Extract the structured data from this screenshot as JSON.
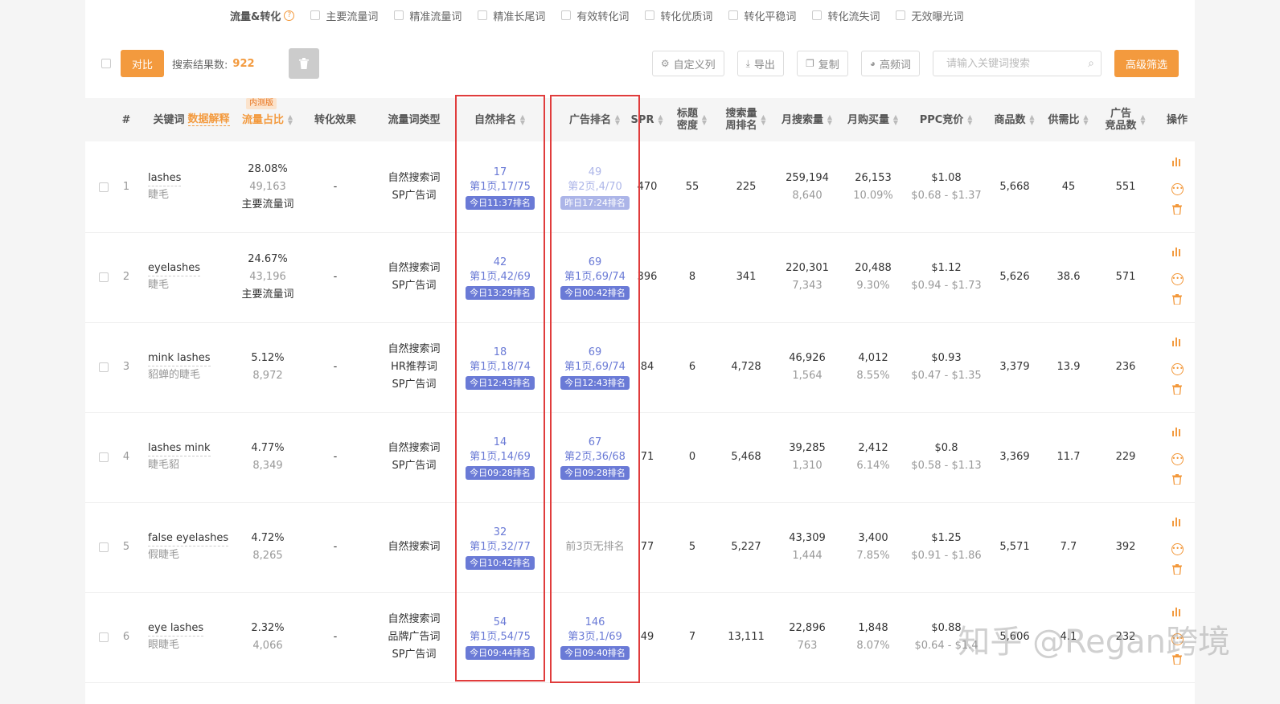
{
  "filters": {
    "title": "流量&转化",
    "help": "?",
    "options": [
      "主要流量词",
      "精准流量词",
      "精准长尾词",
      "有效转化词",
      "转化优质词",
      "转化平稳词",
      "转化流失词",
      "无效曝光词"
    ]
  },
  "toolbar": {
    "compare_label": "对比",
    "result_label": "搜索结果数:",
    "result_count": "922",
    "custom_cols_label": "自定义列",
    "export_label": "导出",
    "copy_label": "复制",
    "high_freq_label": "高频词",
    "search_placeholder": "请输入关键词搜索",
    "advanced_label": "高级筛选"
  },
  "columns": {
    "index": "#",
    "keyword": "关键词",
    "data_explain": "数据解释",
    "traffic_share": "流量占比",
    "beta_badge": "内测版",
    "conversion": "转化效果",
    "traffic_type": "流量词类型",
    "natural_rank": "自然排名",
    "ad_rank": "广告排名",
    "spr": "SPR",
    "title_density_1": "标题",
    "title_density_2": "密度",
    "weekly_rank_1": "搜索量",
    "weekly_rank_2": "周排名",
    "monthly_search": "月搜索量",
    "monthly_purchase": "月购买量",
    "ppc": "PPC竞价",
    "products": "商品数",
    "supply_demand": "供需比",
    "ad_products_1": "广告",
    "ad_products_2": "竞品数",
    "actions": "操作"
  },
  "rows": [
    {
      "idx": "1",
      "kw": "lashes",
      "kw_cn": "睫毛",
      "share": "28.08%",
      "share_val": "49,163",
      "share_tag": "主要流量词",
      "conv": "-",
      "types": [
        "自然搜索词",
        "SP广告词"
      ],
      "nat_num": "17",
      "nat_pg": "第1页,17/75",
      "nat_tag": "今日11:37排名",
      "ad_num": "49",
      "ad_pg": "第2页,4/70",
      "ad_tag": "昨日17:24排名",
      "ad_faded": true,
      "ad_none": "",
      "spr": "470",
      "density": "55",
      "weekly": "225",
      "msearch": "259,194",
      "msearch_sub": "8,640",
      "mbuy": "26,153",
      "mbuy_sub": "10.09%",
      "ppc": "$1.08",
      "ppc_range": "$0.68 - $1.37",
      "products": "5,668",
      "sd": "45",
      "adp": "551"
    },
    {
      "idx": "2",
      "kw": "eyelashes",
      "kw_cn": "睫毛",
      "share": "24.67%",
      "share_val": "43,196",
      "share_tag": "主要流量词",
      "conv": "-",
      "types": [
        "自然搜索词",
        "SP广告词"
      ],
      "nat_num": "42",
      "nat_pg": "第1页,42/69",
      "nat_tag": "今日13:29排名",
      "ad_num": "69",
      "ad_pg": "第1页,69/74",
      "ad_tag": "今日00:42排名",
      "ad_faded": false,
      "ad_none": "",
      "spr": "396",
      "density": "8",
      "weekly": "341",
      "msearch": "220,301",
      "msearch_sub": "7,343",
      "mbuy": "20,488",
      "mbuy_sub": "9.30%",
      "ppc": "$1.12",
      "ppc_range": "$0.94 - $1.73",
      "products": "5,626",
      "sd": "38.6",
      "adp": "571"
    },
    {
      "idx": "3",
      "kw": "mink lashes",
      "kw_cn": "貂蝉的睫毛",
      "share": "5.12%",
      "share_val": "8,972",
      "share_tag": "",
      "conv": "-",
      "types": [
        "自然搜索词",
        "HR推荐词",
        "SP广告词"
      ],
      "nat_num": "18",
      "nat_pg": "第1页,18/74",
      "nat_tag": "今日12:43排名",
      "ad_num": "69",
      "ad_pg": "第1页,69/74",
      "ad_tag": "今日12:43排名",
      "ad_faded": false,
      "ad_none": "",
      "spr": "84",
      "density": "6",
      "weekly": "4,728",
      "msearch": "46,926",
      "msearch_sub": "1,564",
      "mbuy": "4,012",
      "mbuy_sub": "8.55%",
      "ppc": "$0.93",
      "ppc_range": "$0.47 - $1.35",
      "products": "3,379",
      "sd": "13.9",
      "adp": "236"
    },
    {
      "idx": "4",
      "kw": "lashes mink",
      "kw_cn": "睫毛貂",
      "share": "4.77%",
      "share_val": "8,349",
      "share_tag": "",
      "conv": "-",
      "types": [
        "自然搜索词",
        "SP广告词"
      ],
      "nat_num": "14",
      "nat_pg": "第1页,14/69",
      "nat_tag": "今日09:28排名",
      "ad_num": "67",
      "ad_pg": "第2页,36/68",
      "ad_tag": "今日09:28排名",
      "ad_faded": false,
      "ad_none": "",
      "spr": "71",
      "density": "0",
      "weekly": "5,468",
      "msearch": "39,285",
      "msearch_sub": "1,310",
      "mbuy": "2,412",
      "mbuy_sub": "6.14%",
      "ppc": "$0.8",
      "ppc_range": "$0.58 - $1.13",
      "products": "3,369",
      "sd": "11.7",
      "adp": "229"
    },
    {
      "idx": "5",
      "kw": "false eyelashes",
      "kw_cn": "假睫毛",
      "share": "4.72%",
      "share_val": "8,265",
      "share_tag": "",
      "conv": "-",
      "types": [
        "自然搜索词"
      ],
      "nat_num": "32",
      "nat_pg": "第1页,32/77",
      "nat_tag": "今日10:42排名",
      "ad_num": "",
      "ad_pg": "",
      "ad_tag": "",
      "ad_faded": false,
      "ad_none": "前3页无排名",
      "spr": "77",
      "density": "5",
      "weekly": "5,227",
      "msearch": "43,309",
      "msearch_sub": "1,444",
      "mbuy": "3,400",
      "mbuy_sub": "7.85%",
      "ppc": "$1.25",
      "ppc_range": "$0.91 - $1.86",
      "products": "5,571",
      "sd": "7.7",
      "adp": "392"
    },
    {
      "idx": "6",
      "kw": "eye lashes",
      "kw_cn": "眼睫毛",
      "share": "2.32%",
      "share_val": "4,066",
      "share_tag": "",
      "conv": "-",
      "types": [
        "自然搜索词",
        "品牌广告词",
        "SP广告词"
      ],
      "nat_num": "54",
      "nat_pg": "第1页,54/75",
      "nat_tag": "今日09:44排名",
      "ad_num": "146",
      "ad_pg": "第3页,1/69",
      "ad_tag": "今日09:40排名",
      "ad_faded": false,
      "ad_none": "",
      "spr": "49",
      "density": "7",
      "weekly": "13,111",
      "msearch": "22,896",
      "msearch_sub": "763",
      "mbuy": "1,848",
      "mbuy_sub": "8.07%",
      "ppc": "$0.88",
      "ppc_range": "$0.64 - $1.4",
      "products": "5,606",
      "sd": "4.1",
      "adp": "232"
    }
  ],
  "icons": {
    "chart": "bar-chart-icon",
    "more": "more-icon",
    "delete": "trash-icon"
  },
  "watermark": "知乎 @Regan跨境",
  "accent": "#f39a3e",
  "rank_color": "#6a7ad6",
  "highlight_color": "#e03c3c"
}
